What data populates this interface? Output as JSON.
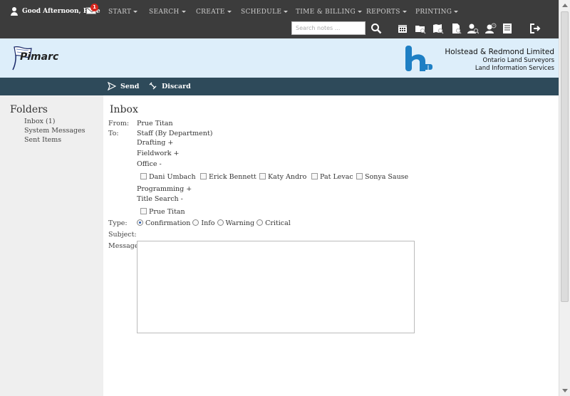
{
  "topbar": {
    "greeting": "Good Afternoon, Prue",
    "mail_count": "1",
    "menus": [
      {
        "label": "START"
      },
      {
        "label": "SEARCH"
      },
      {
        "label": "CREATE"
      },
      {
        "label": "SCHEDULE"
      },
      {
        "label": "TIME & BILLING"
      },
      {
        "label": "REPORTS"
      },
      {
        "label": "PRINTING"
      }
    ],
    "search_placeholder": "Search notes ..."
  },
  "header": {
    "logo_text": "Pimarc",
    "company_name": "Holstead & Redmond Limited",
    "company_line1": "Ontario Land Surveyors",
    "company_line2": "Land Information Services"
  },
  "actions": {
    "send": "Send",
    "discard": "Discard"
  },
  "sidebar": {
    "title": "Folders",
    "items": [
      {
        "label": "Inbox (1)"
      },
      {
        "label": "System Messages"
      },
      {
        "label": "Sent Items"
      }
    ]
  },
  "main": {
    "title": "Inbox",
    "from_label": "From:",
    "from_value": "Prue Titan",
    "to_label": "To:",
    "to_dept": "Staff (By Department)",
    "groups": [
      {
        "label": "Drafting +"
      },
      {
        "label": "Fieldwork +"
      },
      {
        "label": "Office -"
      },
      {
        "label": "Programming +"
      },
      {
        "label": "Title Search -"
      }
    ],
    "office_members": [
      {
        "name": "Dani Umbach"
      },
      {
        "name": "Erick Bennett"
      },
      {
        "name": "Katy Andro"
      },
      {
        "name": "Pat Levac"
      },
      {
        "name": "Sonya Sause"
      }
    ],
    "title_search_members": [
      {
        "name": "Prue Titan"
      }
    ],
    "type_label": "Type:",
    "types": [
      {
        "label": "Confirmation",
        "selected": true
      },
      {
        "label": "Info",
        "selected": false
      },
      {
        "label": "Warning",
        "selected": false
      },
      {
        "label": "Critical",
        "selected": false
      }
    ],
    "subject_label": "Subject:",
    "message_label": "Message:"
  },
  "colors": {
    "topbar": "#3c3c3c",
    "header_band": "#ddeefa",
    "action_bar": "#2e4a5a",
    "sidebar": "#efefef",
    "badge": "#d9251c",
    "logo_blue": "#1e7fc4"
  }
}
